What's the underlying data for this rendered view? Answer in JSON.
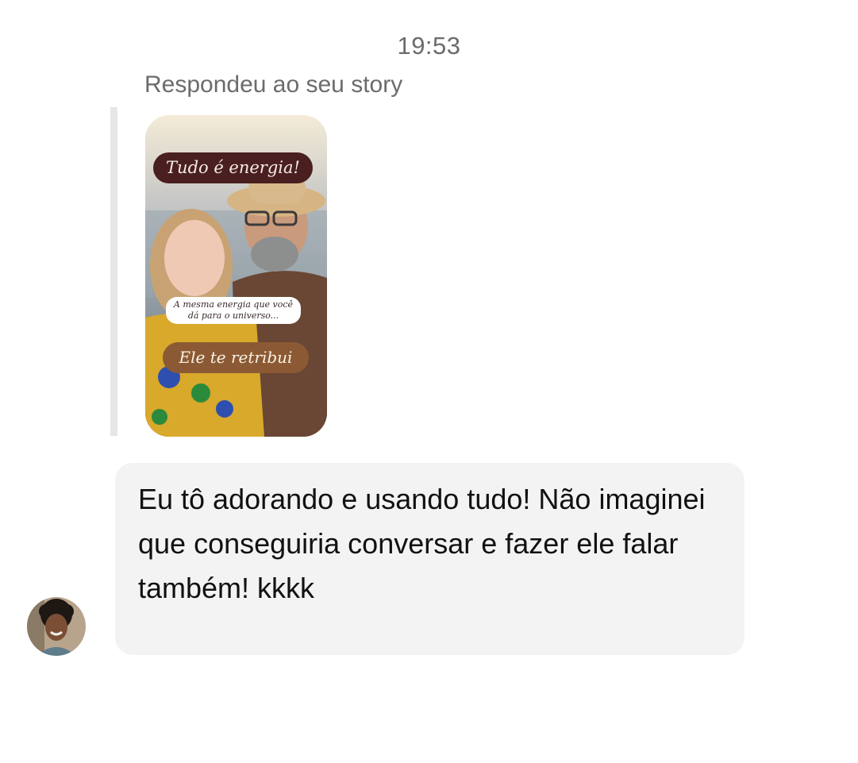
{
  "header": {
    "timestamp": "19:53"
  },
  "story_reply": {
    "label": "Respondeu ao seu story",
    "story": {
      "title": "Tudo é energia!",
      "caption": "A mesma energia que você dá para o universo...",
      "bottom_text": "Ele te retribui"
    }
  },
  "message": {
    "text": "Eu tô adorando e usando tudo! Não imaginei que conseguiria conversar e fazer ele falar também! kkkk"
  },
  "colors": {
    "bubble_background": "#f3f3f3",
    "meta_text": "#6b6b6b",
    "quote_bar": "#e6e6e6",
    "story_title_bg": "#4a1f1f",
    "story_bottom_bg": "#8b5a34"
  }
}
